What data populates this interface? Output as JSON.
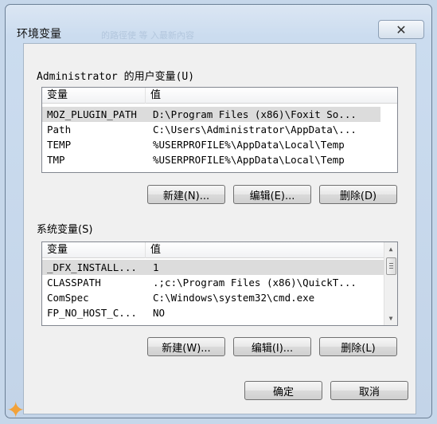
{
  "dialog": {
    "title": "环境变量",
    "close_glyph": "✕",
    "background_ghost": "的路徑使 等  入最新內容",
    "ok_label": "确定",
    "cancel_label": "取消"
  },
  "user_vars": {
    "group_label": "Administrator 的用户变量(U)",
    "columns": [
      "变量",
      "值"
    ],
    "rows": [
      {
        "name": "MOZ_PLUGIN_PATH",
        "value": "D:\\Program Files (x86)\\Foxit So..."
      },
      {
        "name": "Path",
        "value": "C:\\Users\\Administrator\\AppData\\..."
      },
      {
        "name": "TEMP",
        "value": "%USERPROFILE%\\AppData\\Local\\Temp"
      },
      {
        "name": "TMP",
        "value": "%USERPROFILE%\\AppData\\Local\\Temp"
      }
    ],
    "new_label": "新建(N)...",
    "edit_label": "编辑(E)...",
    "delete_label": "删除(D)"
  },
  "system_vars": {
    "group_label": "系统变量(S)",
    "columns": [
      "变量",
      "值"
    ],
    "rows": [
      {
        "name": "_DFX_INSTALL...",
        "value": "1"
      },
      {
        "name": "CLASSPATH",
        "value": ".;c:\\Program Files (x86)\\QuickT..."
      },
      {
        "name": "ComSpec",
        "value": "C:\\Windows\\system32\\cmd.exe"
      },
      {
        "name": "FP_NO_HOST_C...",
        "value": "NO"
      }
    ],
    "new_label": "新建(W)...",
    "edit_label": "编辑(I)...",
    "delete_label": "删除(L)"
  },
  "icons": {
    "scroll_up": "up-arrow-icon",
    "scroll_down": "down-arrow-icon",
    "close": "close-icon"
  }
}
